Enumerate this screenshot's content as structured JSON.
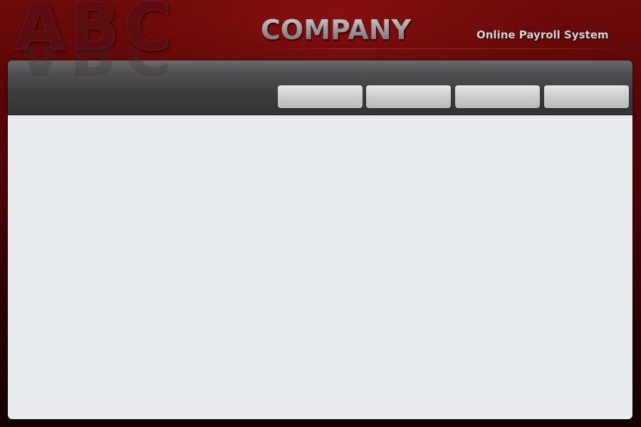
{
  "header": {
    "logo_abc": "ABC",
    "logo_company": "COMPANY",
    "tagline": "Online Payroll System"
  },
  "nav": {
    "buttons": [
      {
        "label": ""
      },
      {
        "label": ""
      },
      {
        "label": ""
      },
      {
        "label": ""
      }
    ]
  },
  "colors": {
    "background": "#4a0505",
    "nav_bar": "#3d3d3f",
    "content": "#e8ebee",
    "button": "#cfcfcf"
  }
}
